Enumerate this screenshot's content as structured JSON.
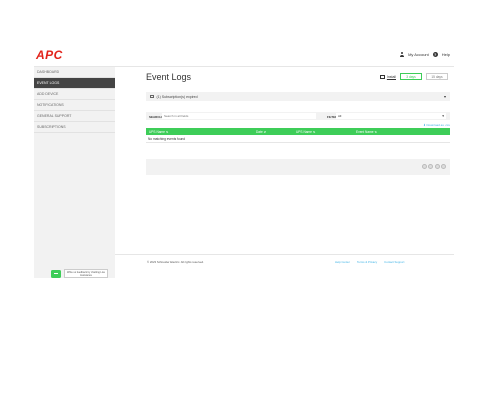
{
  "header": {
    "logo": "APC",
    "account_label": "My Account",
    "help_label": "Help",
    "help_glyph": "?"
  },
  "sidebar": {
    "items": [
      {
        "label": "DASHBOARD",
        "active": false
      },
      {
        "label": "EVENT LOGS",
        "active": true
      },
      {
        "label": "ADD DEVICE",
        "active": false
      },
      {
        "label": "NOTIFICATIONS",
        "active": false
      },
      {
        "label": "GENERAL SUPPORT",
        "active": false
      },
      {
        "label": "SUBSCRIPTIONS",
        "active": false
      }
    ],
    "chat_text": "Write us feedback by chatting Live Assistance"
  },
  "main": {
    "title": "Event Logs",
    "install_label": "Install",
    "tabs": [
      {
        "label": "3 days",
        "selected": true
      },
      {
        "label": "15 days",
        "selected": false
      }
    ],
    "subscription_text": "(1) Subscription(s) expired",
    "search_label": "SEARCH",
    "search_placeholder": "Search in all fields",
    "filter_label": "FILTER",
    "filter_value": "All",
    "download_label": "Download as .csv",
    "columns": [
      "UPS Name ⇅",
      "Date ⇵",
      "UPS Name ⇅",
      "Event Name ⇅"
    ],
    "empty_message": "No matching events found"
  },
  "footer": {
    "copyright": "© 2023 Schneider Electric. All rights reserved.",
    "links": [
      "Help Center",
      "Terms & Privacy",
      "Contact Support"
    ]
  },
  "colors": {
    "accent": "#3dcd58",
    "brand": "#e2231a",
    "link": "#42b4e6"
  }
}
